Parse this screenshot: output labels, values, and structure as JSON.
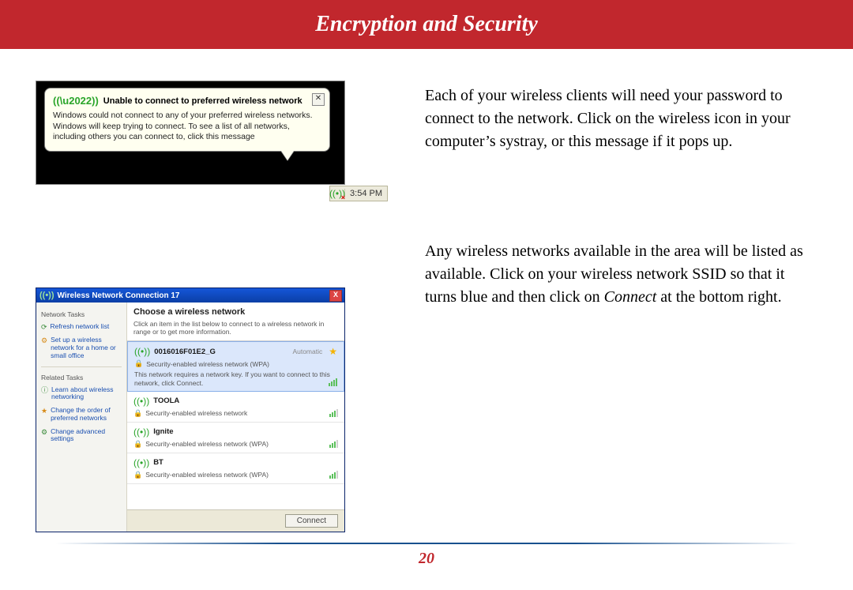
{
  "header": {
    "title": "Encryption and Security"
  },
  "page_number": "20",
  "body": {
    "p1": "Each of your wireless clients will need your password to connect to the network.  Click on the wireless icon in your computer’s systray, or this message if it pops up.",
    "p2a": "Any wireless networks available in the area will be listed as available.  Click on your wireless network SSID so that it turns blue and then click on ",
    "p2_italic": "Connect",
    "p2b": " at the bottom right."
  },
  "balloon": {
    "title": "Unable to connect to preferred wireless network",
    "message": "Windows could not connect to any of your preferred wireless networks. Windows will keep trying to connect. To see a list of all networks, including others you can connect to, click this message",
    "close": "✕",
    "tray_time": "3:54 PM"
  },
  "dialog": {
    "title": "Wireless Network Connection 17",
    "side": {
      "group1": "Network Tasks",
      "task_refresh": "Refresh network list",
      "task_setup": "Set up a wireless network for a home or small office",
      "group2": "Related Tasks",
      "task_learn": "Learn about wireless networking",
      "task_order": "Change the order of preferred networks",
      "task_adv": "Change advanced settings"
    },
    "main": {
      "title": "Choose a wireless network",
      "subtitle": "Click an item in the list below to connect to a wireless network in range or to get more information.",
      "nets": {
        "n0": {
          "name": "0016016F01E2_G",
          "auto": "Automatic",
          "sec": "Security-enabled wireless network (WPA)",
          "note": "This network requires a network key. If you want to connect to this network, click Connect."
        },
        "n1": {
          "name": "TOOLA",
          "sec": "Security-enabled wireless network"
        },
        "n2": {
          "name": "Ignite",
          "sec": "Security-enabled wireless network (WPA)"
        },
        "n3": {
          "name": "BT",
          "sec": "Security-enabled wireless network (WPA)"
        }
      },
      "connect": "Connect"
    }
  }
}
